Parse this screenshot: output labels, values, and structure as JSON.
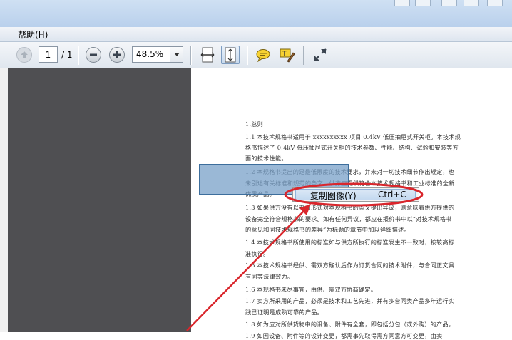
{
  "menubar": {
    "help_label": "帮助(H)"
  },
  "toolbar": {
    "page_number": "1",
    "page_total": "/ 1",
    "zoom_value": "48.5%"
  },
  "context_menu": {
    "copy_image_label": "复制图像(Y)",
    "copy_image_shortcut": "Ctrl+C"
  },
  "document": {
    "lines": [
      "1.总则",
      "1.1 本技术规格书适用于 xxxxxxxxxx 项目 0.4kV 低压抽屉式开关柜。本技术规",
      "格书描述了 0.4kV 低压抽屉式开关柜的技术参数、性能、结构、试验和安装等方",
      "面的技术性能。",
      "1.2 本规格书提出的是最低限度的技术要求，并未对一切技术细节作出规定，也",
      "未引述有关标准和规范的条文，供方应提供符合本技术规格书和工业标准的全新",
      "优质产品。",
      "1.3 如果供方没有以书面形式对本规格书的条文提出异议，则意味着供方提供的",
      "设备完全符合规格书的要求。如有任何异议，都应在报价书中以“对技术规格书",
      "的意见和同技术规格书的差异”为标题的章节中加以详细描述。",
      "1.4 本技术规格书所使用的标准如与供方所执行的标准发生不一致时，按较高标",
      "准执行。",
      "1.5 本技术规格书经供、需双方确认后作为订货合同的技术附件，与合同正文具",
      "有同等法律效力。",
      "1.6 本规格书未尽事宜，由供、需双方协商确定。",
      "1.7 卖方所采用的产品，必须是技术和工艺先进，并有多台同类产品多年运行实",
      "践已证明是成熟可靠的产品。",
      "1.8 如为应对所供货物中的设备、附件有全套，即包括分包（或外购）的产品，",
      "1.9 如因设备、附件等的设计变更，都需事先取得需方同意方可变更，由卖"
    ]
  },
  "colors": {
    "annotation": "#d9262c",
    "selection": "#7aa0c8",
    "canvas_dark": "#4f4f52"
  }
}
